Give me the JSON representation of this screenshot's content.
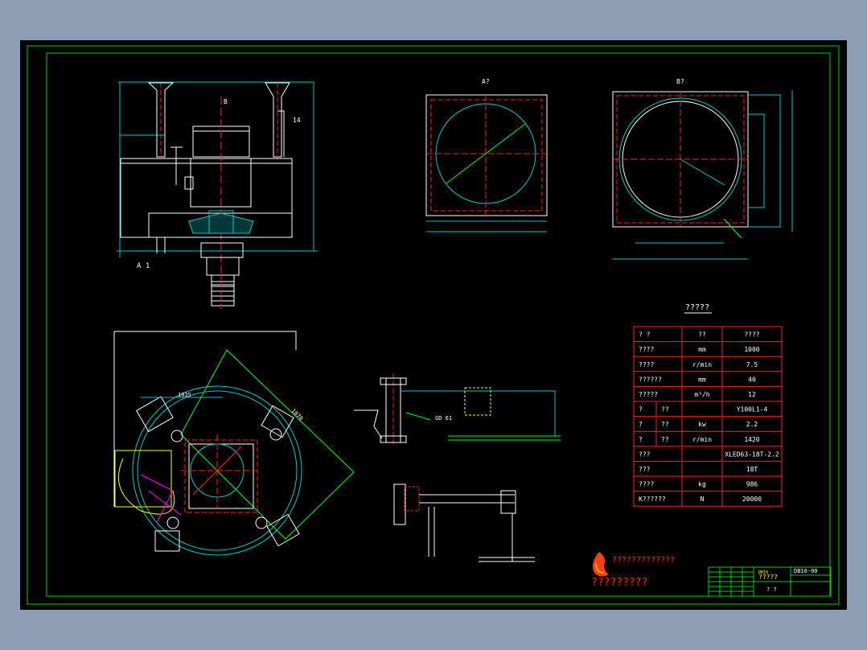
{
  "colors": {
    "frame": "#00d000",
    "cyan": "#00c8c8",
    "red": "#ff2020",
    "white": "#ffffff",
    "yellow": "#ffff00",
    "magenta": "#ff00ff",
    "background": "#000000"
  },
  "views": {
    "section_label": "A 1",
    "mark_b": "B",
    "angle_label": "14",
    "view_a_title": "A?",
    "view_b_title": "B?",
    "dim_1035": "1035",
    "dim_1070": "1070",
    "dim_gd61": "GD 61"
  },
  "table": {
    "title": "?????",
    "header": [
      "?  ?",
      "??",
      "????"
    ],
    "rows": [
      {
        "name": "????",
        "unit": "mm",
        "value": "1000"
      },
      {
        "name": "????",
        "unit": "r/min",
        "value": "7.5"
      },
      {
        "name": "??????",
        "unit": "mm",
        "value": "40"
      },
      {
        "name": "?????",
        "unit": "m³/h",
        "value": "12"
      },
      {
        "name": "?",
        "sub": "??",
        "unit": "",
        "value": "Y100L1-4"
      },
      {
        "name": "?",
        "sub": "??",
        "unit": "kw",
        "value": "2.2"
      },
      {
        "name": "?",
        "sub": "??",
        "unit": "r/min",
        "value": "1420"
      },
      {
        "name": "???",
        "unit": "",
        "value": "XLED63-18T-2.2"
      },
      {
        "name": "???",
        "unit": "",
        "value": "18T"
      },
      {
        "name": "????",
        "unit": "kg",
        "value": "986"
      },
      {
        "name": "K??????",
        "unit": "N",
        "value": "20000"
      }
    ]
  },
  "logo": {
    "line1": "?????????????",
    "line2": "?????????"
  },
  "title_block": {
    "drawing_no": "DB10-00",
    "name": "?????",
    "label1": "?  ?",
    "tag": "DB10"
  }
}
